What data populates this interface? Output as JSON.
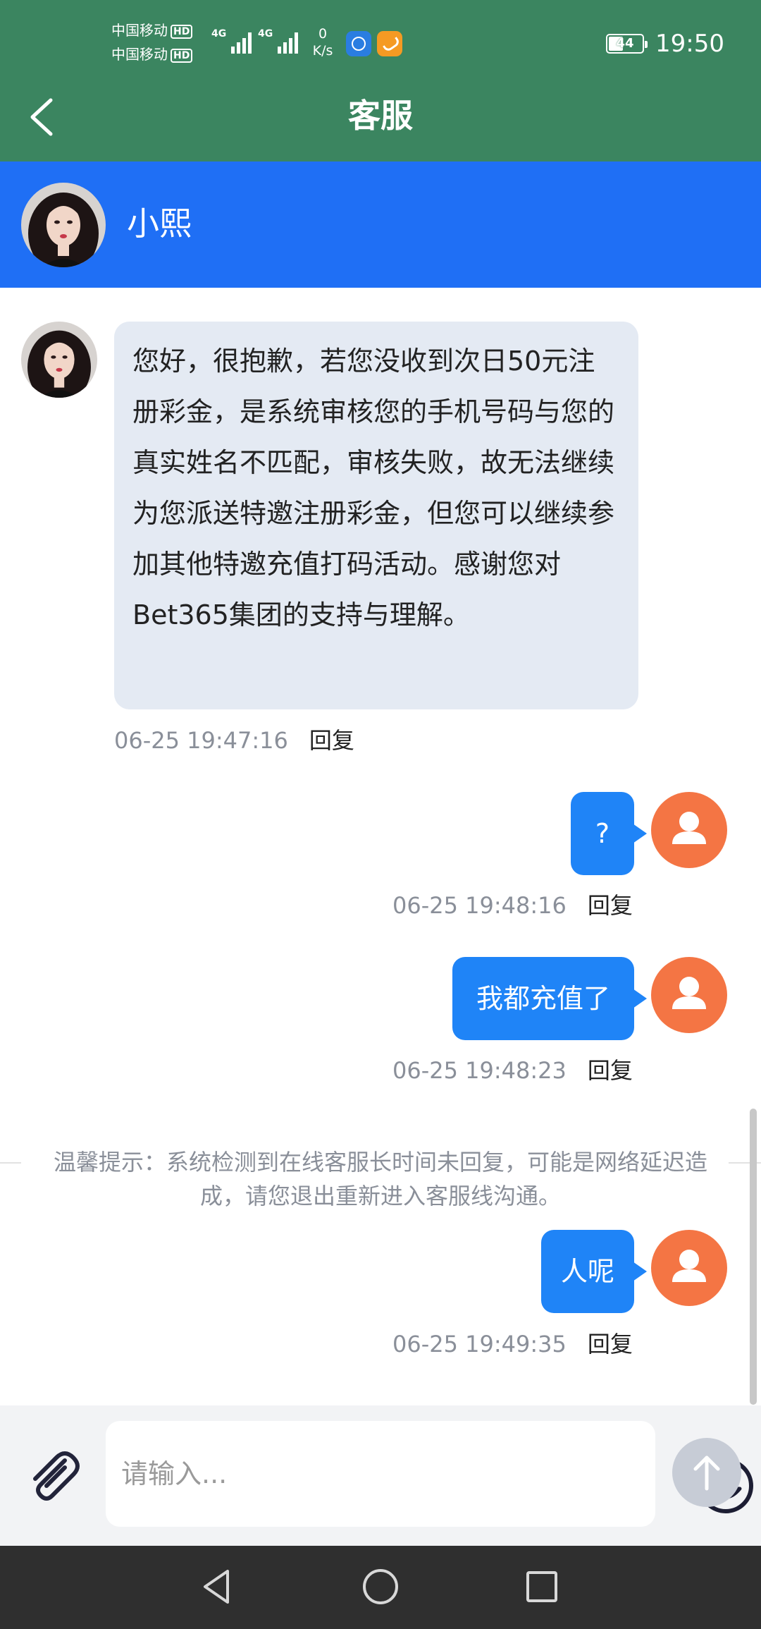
{
  "status_bar": {
    "carrier_1": "中国移动",
    "carrier_2": "中国移动",
    "hd_label": "HD",
    "network_1": "4G",
    "network_2": "4G",
    "speed_value": "0",
    "speed_unit": "K/s",
    "battery": "44",
    "battery_level_percent": 44,
    "time": "19:50"
  },
  "header": {
    "title": "客服",
    "back_icon": "chevron-left-icon"
  },
  "agent": {
    "name": "小熙"
  },
  "messages": [
    {
      "from": "agent",
      "text": "您好，很抱歉，若您没收到次日50元注册彩金，是系统审核您的手机号码与您的真实姓名不匹配，审核失败，故无法继续为您派送特邀注册彩金，但您可以继续参加其他特邀充值打码活动。感谢您对Bet365集团的支持与理解。",
      "time": "06-25 19:47:16",
      "reply": "回复"
    },
    {
      "from": "user",
      "text": "?",
      "time": "06-25 19:48:16",
      "reply": "回复"
    },
    {
      "from": "user",
      "text": "我都充值了",
      "time": "06-25 19:48:23",
      "reply": "回复"
    },
    {
      "from": "user",
      "text": "人呢",
      "time": "06-25 19:49:35",
      "reply": "回复"
    }
  ],
  "system_notice": "温馨提示：系统检测到在线客服长时间未回复，可能是网络延迟造成，请您退出重新进入客服线沟通。",
  "input": {
    "placeholder": "请输入...",
    "value": "",
    "attach_icon": "paperclip-icon",
    "emoji_icon": "smiley-icon",
    "send_icon": "arrow-up-icon"
  },
  "colors": {
    "status_bar": "#3b8560",
    "agent_bar": "#1f6ff5",
    "user_bubble": "#1f84f7",
    "agent_bubble": "#e4eaf3",
    "user_avatar": "#f47544",
    "send_button": "#c7ccd6"
  }
}
